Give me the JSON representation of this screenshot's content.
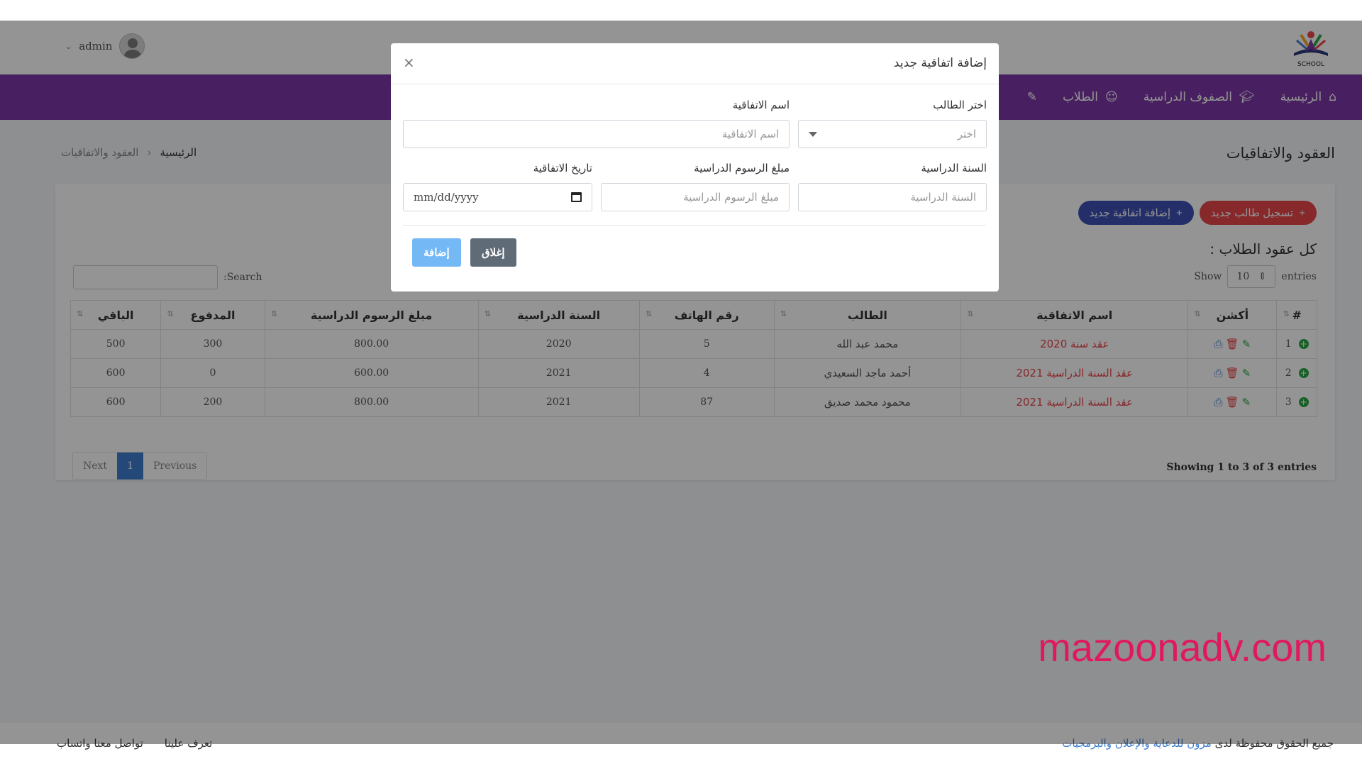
{
  "header": {
    "user_name": "admin",
    "logo_text": "SCHOOL"
  },
  "nav": {
    "items": [
      {
        "label": "الرئيسية",
        "icon": "home-icon"
      },
      {
        "label": "الصفوف الدراسية",
        "icon": "graduation-cap-icon"
      },
      {
        "label": "الطلاب",
        "icon": "student-icon"
      },
      {
        "label": "",
        "icon": "contract-icon"
      }
    ]
  },
  "page": {
    "title": "العقود والاتفاقيات",
    "breadcrumb_home": "الرئيسية",
    "breadcrumb_current": "العقود والاتفاقيات"
  },
  "card": {
    "register_button": "تسجيل طالب جديد",
    "add_agreement_button": "إضافة اتفاقية جديد",
    "title": "كل عقود الطلاب :",
    "show_label": "Show",
    "entries_label": "entries",
    "entries_value": "10",
    "search_label": "Search:",
    "columns": [
      "#",
      "أكشن",
      "اسم الاتفاقية",
      "الطالب",
      "رقم الهاتف",
      "السنة الدراسية",
      "مبلغ الرسوم الدراسية",
      "المدفوع",
      "الباقي"
    ],
    "rows": [
      {
        "num": "1",
        "agreement": "عقد سنة 2020",
        "student": "محمد عبد الله",
        "phone": "5",
        "year": "2020",
        "fees": "800.00",
        "paid": "300",
        "remaining": "500"
      },
      {
        "num": "2",
        "agreement": "عقد السنة الدراسية 2021",
        "student": "أحمد ماجد السعيدي",
        "phone": "4",
        "year": "2021",
        "fees": "600.00",
        "paid": "0",
        "remaining": "600"
      },
      {
        "num": "3",
        "agreement": "عقد السنة الدراسية 2021",
        "student": "محمود محمد صديق",
        "phone": "87",
        "year": "2021",
        "fees": "800.00",
        "paid": "200",
        "remaining": "600"
      }
    ],
    "info": "Showing 1 to 3 of 3 entries",
    "pager": {
      "previous": "Previous",
      "page": "1",
      "next": "Next"
    }
  },
  "modal": {
    "title": "إضافة اتفاقية جديد",
    "close_symbol": "×",
    "student_label": "اختر الطالب",
    "student_placeholder": "اختر",
    "agreement_name_label": "اسم الاتفاقية",
    "agreement_name_placeholder": "اسم الاتفاقية",
    "year_label": "السنة الدراسية",
    "year_placeholder": "السنة الدراسية",
    "fees_label": "مبلغ الرسوم الدراسية",
    "fees_placeholder": "مبلغ الرسوم الدراسية",
    "date_label": "تاريخ الاتفاقية",
    "date_placeholder": "mm/dd/yyyy",
    "close_button": "إغلاق",
    "add_button": "إضافة"
  },
  "footer": {
    "rights_prefix": "جميع الحقوق محفوظة لدى",
    "rights_brand": "مزون للدعاية والإعلان والبرمجيات",
    "about": "تعرف علينا",
    "contact": "تواصل معنا واتساب"
  },
  "watermark": "mazoonadv.com",
  "colors": {
    "nav": "#7d38a8",
    "red": "#e8464a",
    "blue": "#3f51b5",
    "link": "#3f7fd0",
    "watermark": "#e0195e"
  }
}
